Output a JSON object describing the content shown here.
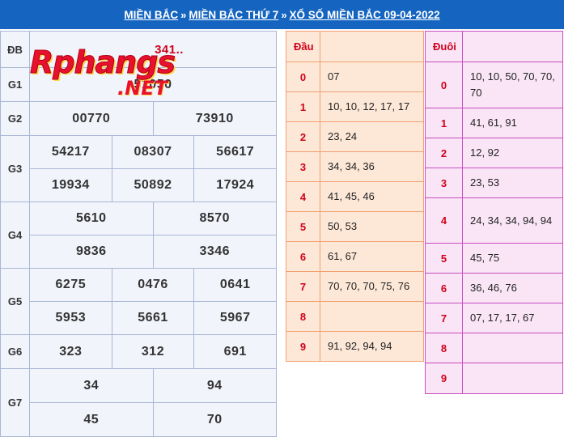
{
  "breadcrumb": {
    "items": [
      "MIỀN BẮC",
      "MIỀN BẮC THỨ 7",
      "XỔ SỐ MIỀN BẮC 09-04-2022"
    ],
    "separator": "»"
  },
  "logo": {
    "line1": "Rphangs",
    "line2": ".NET"
  },
  "results": {
    "db": {
      "label": "ĐB",
      "value": "341.."
    },
    "g1": {
      "label": "G1",
      "values": [
        "51050"
      ]
    },
    "g2": {
      "label": "G2",
      "values": [
        "00770",
        "73910"
      ]
    },
    "g3": {
      "label": "G3",
      "values": [
        "54217",
        "08307",
        "56617",
        "19934",
        "50892",
        "17924"
      ]
    },
    "g4": {
      "label": "G4",
      "values": [
        "5610",
        "8570",
        "9836",
        "3346"
      ]
    },
    "g5": {
      "label": "G5",
      "values": [
        "6275",
        "0476",
        "0641",
        "5953",
        "5661",
        "5967"
      ]
    },
    "g6": {
      "label": "G6",
      "values": [
        "323",
        "312",
        "691"
      ]
    },
    "g7": {
      "label": "G7",
      "values": [
        "34",
        "94",
        "45",
        "70"
      ]
    }
  },
  "dau": {
    "header": "Đầu",
    "rows": [
      {
        "k": "0",
        "v": "07"
      },
      {
        "k": "1",
        "v": "10, 10, 12, 17, 17"
      },
      {
        "k": "2",
        "v": "23, 24"
      },
      {
        "k": "3",
        "v": "34, 34, 36"
      },
      {
        "k": "4",
        "v": "41, 45, 46"
      },
      {
        "k": "5",
        "v": "50, 53"
      },
      {
        "k": "6",
        "v": "61, 67"
      },
      {
        "k": "7",
        "v": "70, 70, 70, 75, 76"
      },
      {
        "k": "8",
        "v": ""
      },
      {
        "k": "9",
        "v": "91, 92, 94, 94"
      }
    ]
  },
  "duoi": {
    "header": "Đuôi",
    "rows": [
      {
        "k": "0",
        "v": "10, 10, 50, 70, 70, 70"
      },
      {
        "k": "1",
        "v": "41, 61, 91"
      },
      {
        "k": "2",
        "v": "12, 92"
      },
      {
        "k": "3",
        "v": "23, 53"
      },
      {
        "k": "4",
        "v": "24, 34, 34, 94, 94"
      },
      {
        "k": "5",
        "v": "45, 75"
      },
      {
        "k": "6",
        "v": "36, 46, 76"
      },
      {
        "k": "7",
        "v": "07, 17, 17, 67"
      },
      {
        "k": "8",
        "v": ""
      },
      {
        "k": "9",
        "v": ""
      }
    ]
  }
}
